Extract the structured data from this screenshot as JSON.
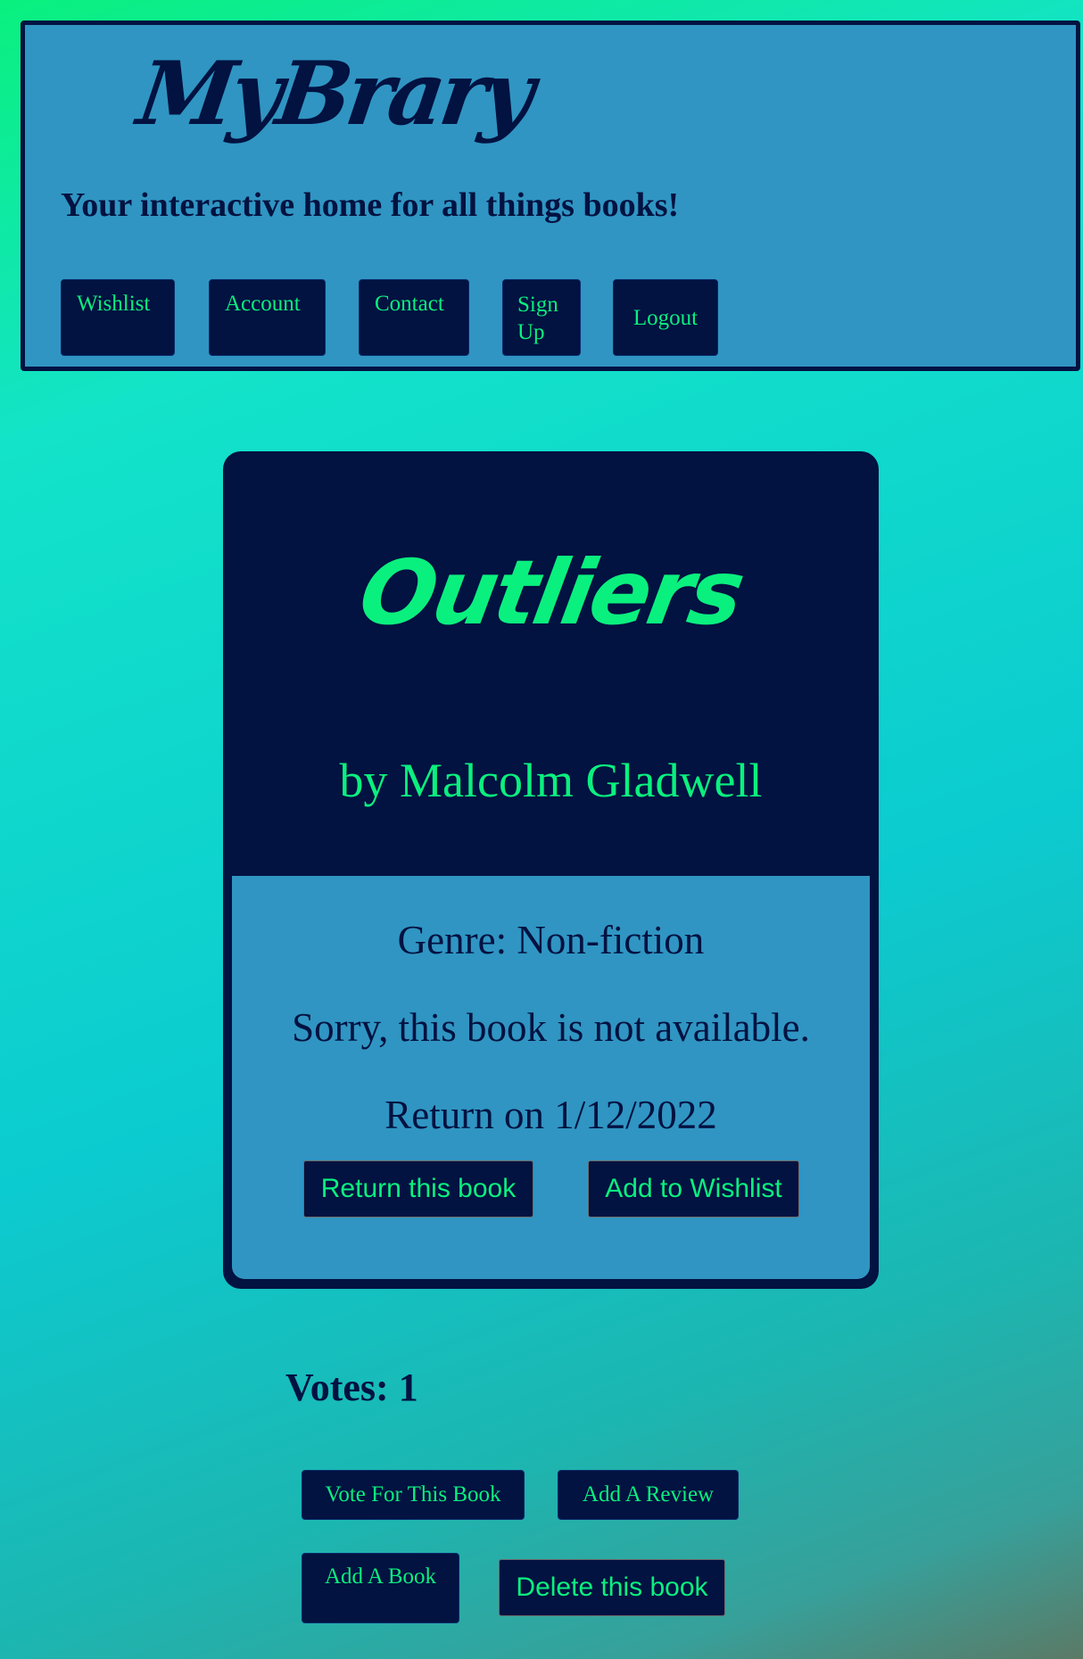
{
  "header": {
    "logo": "MyBrary",
    "tagline": "Your interactive home for all things books!",
    "nav": {
      "wishlist": "Wishlist",
      "account": "Account",
      "contact": "Contact",
      "signup": "Sign Up",
      "logout": "Logout"
    }
  },
  "book": {
    "title": "Outliers",
    "author": "by Malcolm Gladwell",
    "genre": "Genre: Non-fiction",
    "availability": "Sorry, this book is not available.",
    "return_date": "Return on 1/12/2022",
    "return_button": "Return this book",
    "wishlist_button": "Add to Wishlist"
  },
  "votes": {
    "text": "Votes: 1"
  },
  "actions": {
    "vote": "Vote For This Book",
    "review": "Add A Review",
    "add_book": "Add A Book",
    "delete": "Delete this book"
  },
  "colors": {
    "navy": "#021241",
    "blue_panel": "#3095c2",
    "accent_green": "#0af07e"
  }
}
